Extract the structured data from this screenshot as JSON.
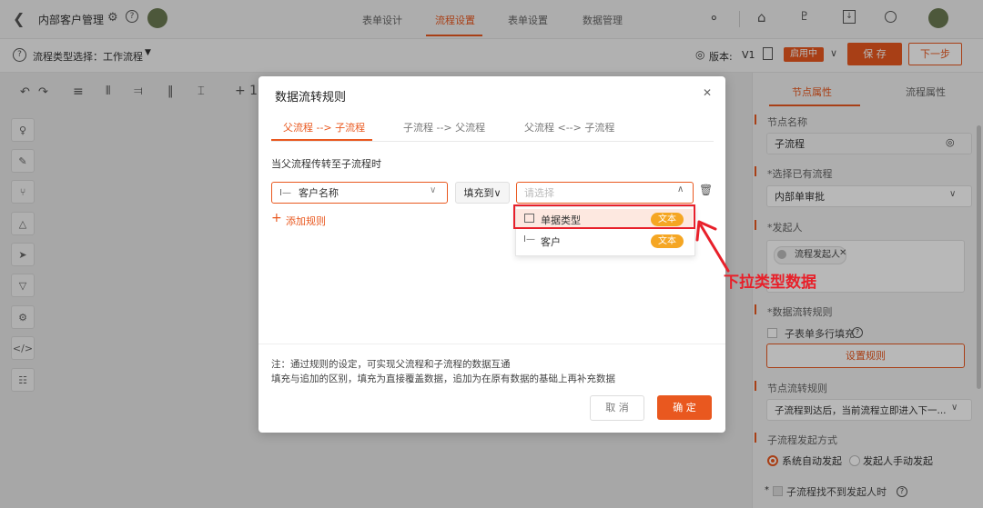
{
  "app": {
    "title": "内部客户管理",
    "tabs": [
      "表单设计",
      "流程设置",
      "表单设置",
      "数据管理"
    ],
    "active_tab": 1,
    "accent": "#e9581f"
  },
  "subbar": {
    "flow_type_label": "流程类型选择：工作流程",
    "version_label": "版本:",
    "version_value": "V1",
    "status": "启用中",
    "save": "保 存",
    "next": "下一步"
  },
  "toolbar": {
    "add": "+ 1"
  },
  "right_panel": {
    "tabs": [
      "节点属性",
      "流程属性"
    ],
    "node_name_label": "节点名称",
    "node_name_value": "子流程",
    "choose_flow_label": "*选择已有流程",
    "choose_flow_value": "内部单审批",
    "initiator_label": "*发起人",
    "initiator_chip": "流程发起人",
    "data_rule_label": "*数据流转规则",
    "sub_multi_fill": "子表单多行填充",
    "set_rule": "设置规则",
    "node_flow_rule_label": "节点流转规则",
    "node_flow_rule_value": "子流程到达后，当前流程立即进入下一...",
    "sub_start_label": "子流程发起方式",
    "radio_auto": "系统自动发起",
    "radio_manual": "发起人手动发起",
    "no_initiator": "子流程找不到发起人时"
  },
  "modal": {
    "title": "数据流转规则",
    "tabs": [
      "父流程 --> 子流程",
      "子流程 --> 父流程",
      "父流程 <--> 子流程"
    ],
    "active_tab": 0,
    "section_label": "当父流程传转至子流程时",
    "source_field": "客户名称",
    "action": "填充到∨",
    "target_placeholder": "请选择",
    "add_rule": "添加规则",
    "options": [
      {
        "label": "单据类型",
        "tag": "文本"
      },
      {
        "label": "客户",
        "tag": "文本"
      }
    ],
    "note1": "注：通过规则的设定，可实现父流程和子流程的数据互通",
    "note2": "填充与追加的区别，填充为直接覆盖数据，追加为在原有数据的基础上再补充数据",
    "cancel": "取 消",
    "ok": "确 定"
  },
  "annotation": {
    "text": "下拉类型数据",
    "color": "#e8202a"
  }
}
